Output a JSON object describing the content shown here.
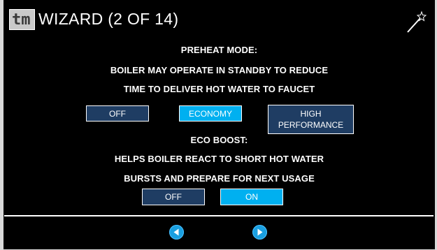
{
  "header": {
    "title": "WIZARD (2 OF 14)",
    "logo_text": "tm"
  },
  "preheat": {
    "heading": "PREHEAT MODE:",
    "desc_line1": "BOILER MAY OPERATE IN STANDBY TO REDUCE",
    "desc_line2": "TIME TO DELIVER HOT WATER TO FAUCET",
    "options": [
      "OFF",
      "ECONOMY",
      "HIGH",
      "PERFORMANCE"
    ],
    "selected": "ECONOMY"
  },
  "eco_boost": {
    "heading": "ECO BOOST:",
    "desc_line1": "HELPS BOILER REACT TO SHORT HOT WATER",
    "desc_line2": "BURSTS AND PREPARE FOR NEXT USAGE",
    "options": [
      "OFF",
      "ON"
    ],
    "selected": "ON"
  },
  "icons": {
    "wand": "magic-wand-icon",
    "back": "arrow-left-circle-icon",
    "next": "arrow-right-circle-icon"
  },
  "colors": {
    "background": "#000000",
    "button_unselected": "#1f3d63",
    "button_selected": "#00b0f0",
    "nav_button": "#1a9fe0"
  }
}
